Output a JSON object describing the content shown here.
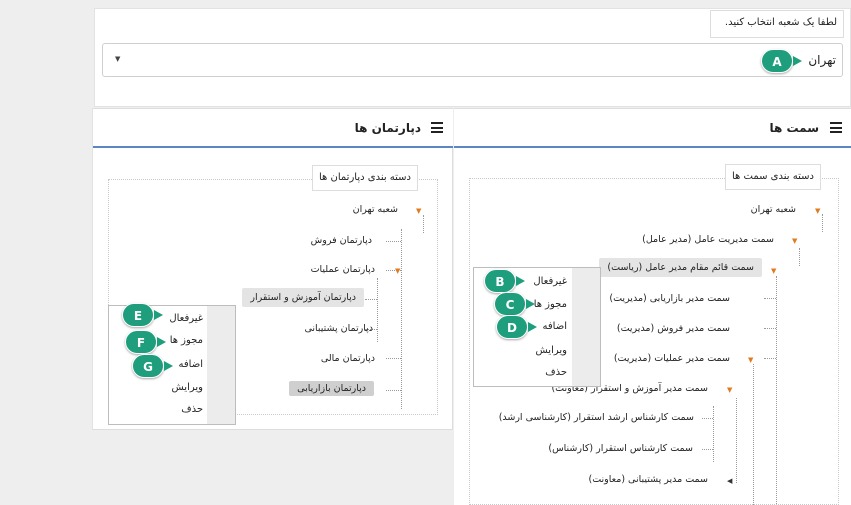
{
  "branch": {
    "prompt": "لطفا یک شعبه انتخاب کنید.",
    "selected": "تهران"
  },
  "departments": {
    "title": "دپارتمان ها",
    "group_label": "دسته بندی دپارتمان ها",
    "tree": [
      "شعبه تهران",
      "دپارتمان فروش",
      "دپارتمان عملیات",
      "دپارتمان آموزش و استقرار",
      "دپارتمان پشتیبانی",
      "دپارتمان مالی",
      "دپارتمان بازاریابی"
    ],
    "menu": [
      "غیرفعال",
      "مجوز ها",
      "اضافه",
      "ویرایش",
      "حذف"
    ]
  },
  "positions": {
    "title": "سمت ها",
    "group_label": "دسته بندی سمت ها",
    "tree": [
      "شعبه تهران",
      "سمت مدیریت عامل (مدیر عامل)",
      "سمت قائم مقام مدیر عامل (ریاست)",
      "سمت مدیر بازاریابی (مدیریت)",
      "سمت مدیر فروش (مدیریت)",
      "سمت مدیر عملیات (مدیریت)",
      "سمت مدیر آموزش و استقرار (معاونت)",
      "سمت کارشناس ارشد استقرار (کارشناسی ارشد)",
      "سمت کارشناس استقرار (کارشناس)",
      "سمت مدیر پشتیبانی (معاونت)"
    ],
    "menu": [
      "غیرفعال",
      "مجوز ها",
      "اضافه",
      "ویرایش",
      "حذف"
    ]
  },
  "callouts": [
    "A",
    "B",
    "C",
    "D",
    "E",
    "F",
    "G"
  ],
  "colors": {
    "callout": "#1e9e7c",
    "header_underline": "#5b86c3",
    "tree_caret": "#e07c20"
  }
}
